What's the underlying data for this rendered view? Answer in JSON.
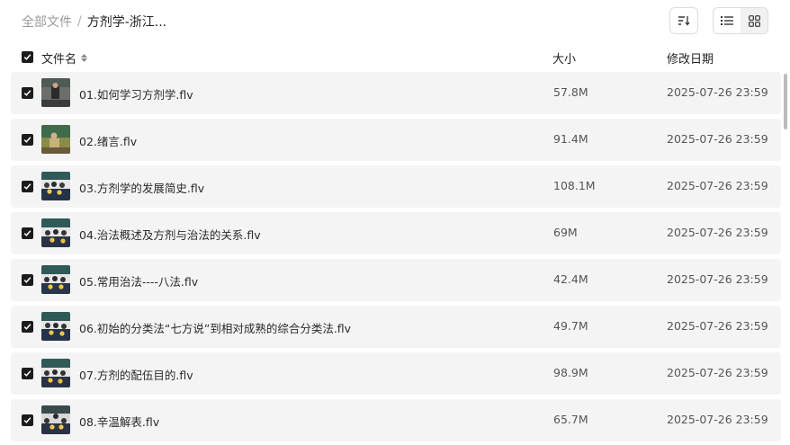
{
  "breadcrumb": {
    "root": "全部文件",
    "separator": "/",
    "current": "方剂学-浙江..."
  },
  "columns": {
    "name": "文件名",
    "size": "大小",
    "modified": "修改日期"
  },
  "toolbar": {
    "sort_icon": "sort-icon",
    "list_view_icon": "list-view-icon",
    "grid_view_icon": "grid-view-icon"
  },
  "files": [
    {
      "name": "01.如何学习方剂学.flv",
      "size": "57.8M",
      "date": "2025-07-26 23:59",
      "checked": true
    },
    {
      "name": "02.绪言.flv",
      "size": "91.4M",
      "date": "2025-07-26 23:59",
      "checked": true
    },
    {
      "name": "03.方剂学的发展简史.flv",
      "size": "108.1M",
      "date": "2025-07-26 23:59",
      "checked": true
    },
    {
      "name": "04.治法概述及方剂与治法的关系.flv",
      "size": "69M",
      "date": "2025-07-26 23:59",
      "checked": true
    },
    {
      "name": "05.常用治法----八法.flv",
      "size": "42.4M",
      "date": "2025-07-26 23:59",
      "checked": true
    },
    {
      "name": "06.初始的分类法“七方说”到相对成熟的综合分类法.flv",
      "size": "49.7M",
      "date": "2025-07-26 23:59",
      "checked": true
    },
    {
      "name": "07.方剂的配伍目的.flv",
      "size": "98.9M",
      "date": "2025-07-26 23:59",
      "checked": true
    },
    {
      "name": "08.辛温解表.flv",
      "size": "65.7M",
      "date": "2025-07-26 23:59",
      "checked": true
    }
  ]
}
